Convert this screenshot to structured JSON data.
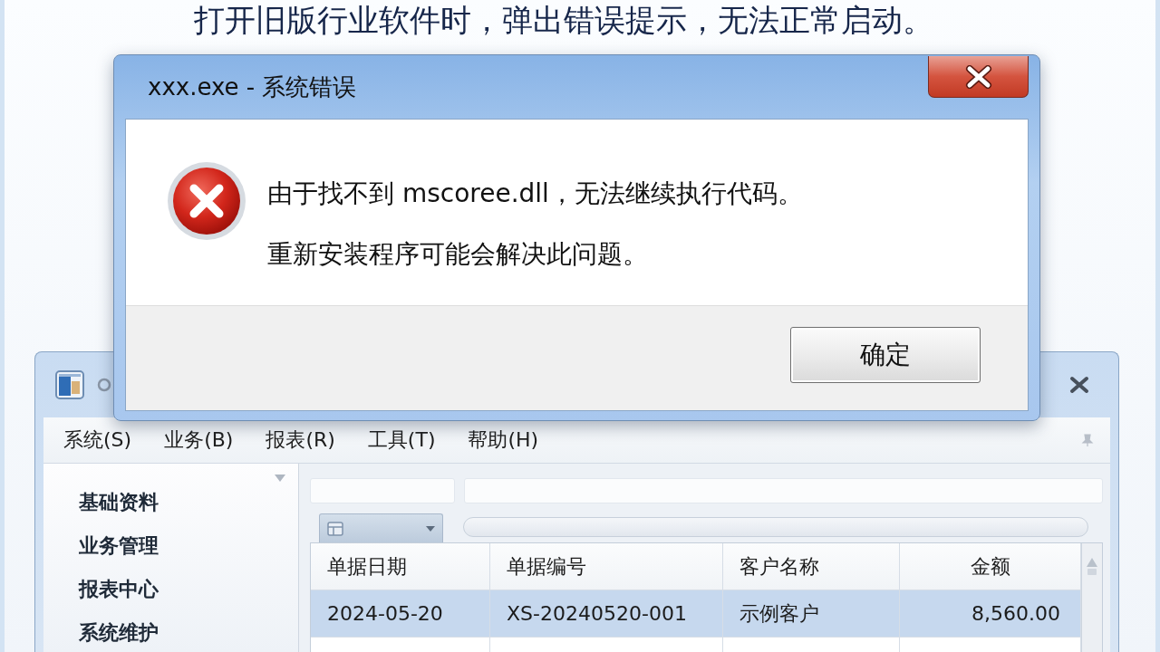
{
  "caption": "打开旧版行业软件时，弹出错误提示，无法正常启动。",
  "dialog": {
    "title": "xxx.exe - 系统错误",
    "message_lines": [
      "由于找不到 mscoree.dll，无法继续执行代码。",
      "重新安装程序可能会解决此问题。"
    ],
    "buttons": [
      "确定"
    ]
  },
  "app_window": {
    "menu": [
      "系统(S)",
      "业务(B)",
      "报表(R)",
      "工具(T)",
      "帮助(H)"
    ],
    "sidebar": {
      "items": [
        "基础资料",
        "业务管理",
        "报表中心",
        "系统维护"
      ]
    },
    "table": {
      "columns": [
        "单据日期",
        "单据编号",
        "客户名称",
        "金额"
      ],
      "rows": [
        {
          "cells": [
            "2024-05-20",
            "XS-20240520-001",
            "示例客户",
            "8,560.00"
          ],
          "selected": true
        }
      ]
    }
  }
}
